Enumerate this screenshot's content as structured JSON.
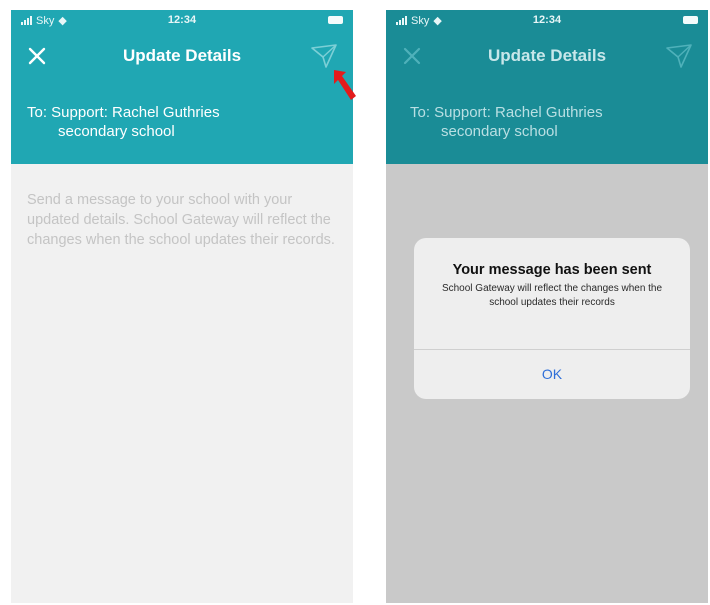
{
  "left_phone": {
    "status": {
      "carrier": "Sky",
      "time": "12:34"
    },
    "nav": {
      "title": "Update Details",
      "close_icon": "close-icon",
      "send_icon": "send-icon"
    },
    "recipient": {
      "line1": "To: Support: Rachel Guthries",
      "line2": "secondary school"
    },
    "message_placeholder": "Send a message to your school with your updated details. School Gateway will reflect the changes when the school updates their records."
  },
  "right_phone": {
    "status": {
      "carrier": "Sky",
      "time": "12:34"
    },
    "nav": {
      "title": "Update Details"
    },
    "recipient": {
      "line1": "To: Support: Rachel Guthries",
      "line2": "secondary school"
    },
    "alert": {
      "title": "Your message has been sent",
      "message": "School Gateway will reflect the changes when the school updates their records",
      "ok_label": "OK"
    }
  },
  "annotation": {
    "arrow_icon": "red-arrow-icon",
    "color": "#e31b1b"
  },
  "colors": {
    "header_teal": "#20a7b3",
    "header_teal_dim": "#1a8c96",
    "dim_overlay": "#c9c9c9",
    "link_blue": "#2f6fd8"
  }
}
